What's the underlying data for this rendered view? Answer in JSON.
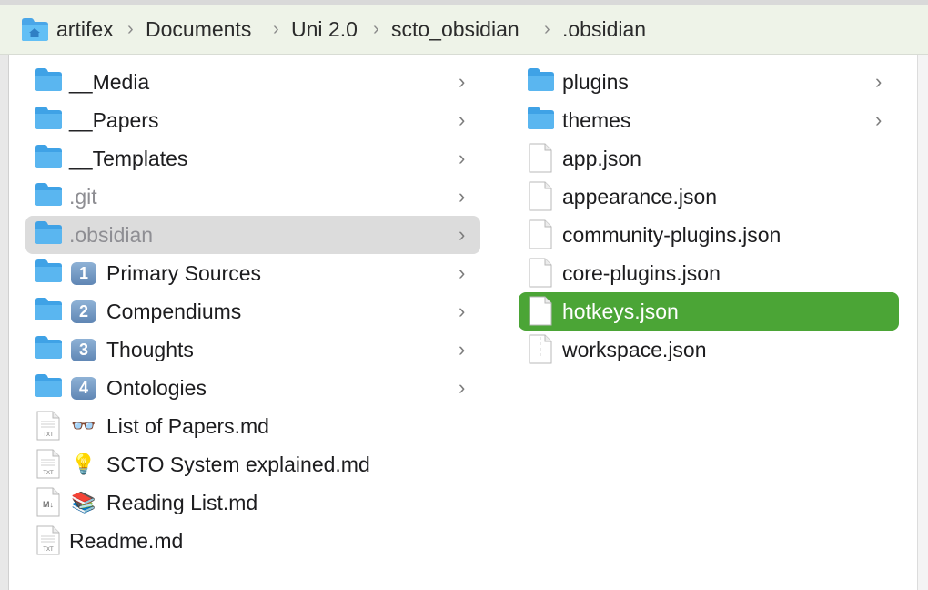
{
  "breadcrumb": {
    "items": [
      "artifex",
      "Documents",
      "Uni 2.0",
      "scto_obsidian",
      ".obsidian"
    ],
    "separator": "›"
  },
  "column1": {
    "items": [
      {
        "label": "__Media",
        "kind": "folder"
      },
      {
        "label": "__Papers",
        "kind": "folder"
      },
      {
        "label": "__Templates",
        "kind": "folder"
      },
      {
        "label": ".git",
        "kind": "folder",
        "dimmed": true
      },
      {
        "label": ".obsidian",
        "kind": "folder",
        "dimmed": true,
        "selected": true
      },
      {
        "label": "Primary Sources",
        "kind": "folder",
        "badge": "1"
      },
      {
        "label": "Compendiums",
        "kind": "folder",
        "badge": "2"
      },
      {
        "label": "Thoughts",
        "kind": "folder",
        "badge": "3"
      },
      {
        "label": "Ontologies",
        "kind": "folder",
        "badge": "4"
      },
      {
        "label": "List of Papers.md",
        "kind": "txt-file",
        "emoji": "👓"
      },
      {
        "label": "SCTO System explained.md",
        "kind": "txt-file",
        "emoji": "💡"
      },
      {
        "label": "Reading List.md",
        "kind": "md-file",
        "emoji": "📚"
      },
      {
        "label": "Readme.md",
        "kind": "txt-file"
      }
    ]
  },
  "column2": {
    "items": [
      {
        "label": "plugins",
        "kind": "folder"
      },
      {
        "label": "themes",
        "kind": "folder"
      },
      {
        "label": "app.json",
        "kind": "file"
      },
      {
        "label": "appearance.json",
        "kind": "file"
      },
      {
        "label": "community-plugins.json",
        "kind": "file"
      },
      {
        "label": "core-plugins.json",
        "kind": "file"
      },
      {
        "label": "hotkeys.json",
        "kind": "file",
        "selected": true
      },
      {
        "label": "workspace.json",
        "kind": "file"
      }
    ]
  },
  "icons": {
    "folder": "folder-icon",
    "file": "file-icon",
    "txt_file": "txt-file-icon",
    "md_file": "markdown-file-icon",
    "chevron": "chevron-right-icon",
    "home_folder": "home-folder-icon"
  },
  "file_badges": {
    "txt": "TXT",
    "md": "M↓"
  },
  "colors": {
    "folder": "#5ab6f0",
    "selection_active": "#4ba536",
    "selection_inactive": "#dcdcdc",
    "pathbar": "#eef3e8"
  }
}
